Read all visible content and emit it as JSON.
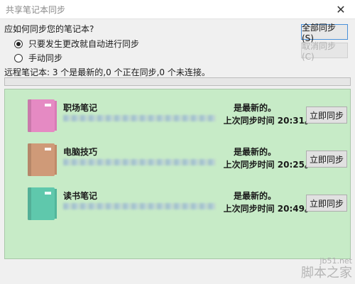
{
  "window": {
    "title": "共享笔记本同步"
  },
  "question": "应如何同步您的笔记本?",
  "options": [
    {
      "label": "只要发生更改就自动进行同步",
      "checked": true
    },
    {
      "label": "手动同步",
      "checked": false
    }
  ],
  "buttons": {
    "sync_all": "全部同步(S)",
    "cancel_sync": "取消同步(C)"
  },
  "status_line": "远程笔记本: 3 个是最新的,0 个正在同步,0 个未连接。",
  "notebooks": [
    {
      "name": "职场笔记",
      "status": "是最新的。",
      "last_sync_label": "上次同步时间",
      "last_sync_time": "20:31。",
      "sync_button": "立即同步",
      "color": "#e58ac3"
    },
    {
      "name": "电脑技巧",
      "status": "是最新的。",
      "last_sync_label": "上次同步时间",
      "last_sync_time": "20:25。",
      "sync_button": "立即同步",
      "color": "#cf9a78"
    },
    {
      "name": "读书笔记",
      "status": "是最新的。",
      "last_sync_label": "上次同步时间",
      "last_sync_time": "20:49。",
      "sync_button": "立即同步",
      "color": "#5fc8ac"
    }
  ],
  "watermark": {
    "site": "jb51.net",
    "brand": "脚本之家"
  }
}
